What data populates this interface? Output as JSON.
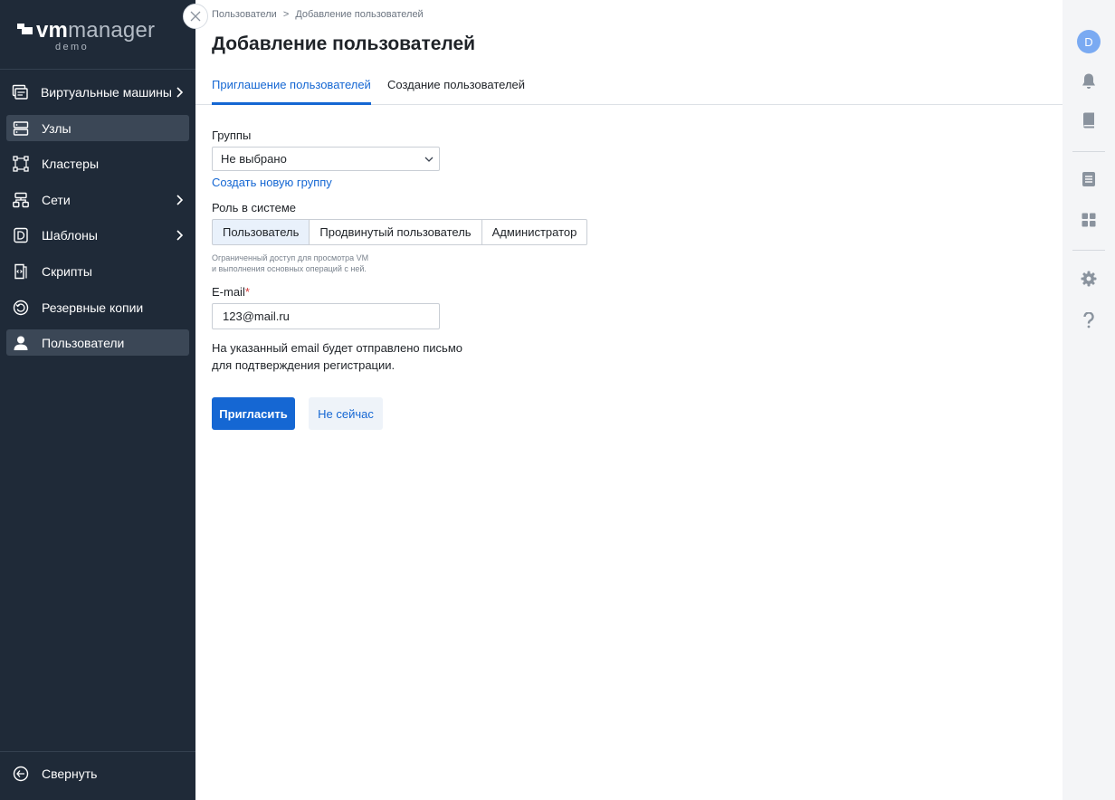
{
  "brand": {
    "vm": "vm",
    "manager": "manager",
    "demo": "demo"
  },
  "sidebar": {
    "items": [
      {
        "label": "Виртуальные машины",
        "icon": "vm-icon",
        "has_arrow": true,
        "active": false
      },
      {
        "label": "Узлы",
        "icon": "nodes-icon",
        "has_arrow": false,
        "active": true
      },
      {
        "label": "Кластеры",
        "icon": "clusters-icon",
        "has_arrow": false,
        "active": false
      },
      {
        "label": "Сети",
        "icon": "network-icon",
        "has_arrow": true,
        "active": false
      },
      {
        "label": "Шаблоны",
        "icon": "templates-icon",
        "has_arrow": true,
        "active": false
      },
      {
        "label": "Скрипты",
        "icon": "scripts-icon",
        "has_arrow": false,
        "active": false
      },
      {
        "label": "Резервные копии",
        "icon": "backup-icon",
        "has_arrow": false,
        "active": false
      },
      {
        "label": "Пользователи",
        "icon": "user-icon",
        "has_arrow": false,
        "active": true
      }
    ],
    "collapse_label": "Свернуть"
  },
  "breadcrumb": {
    "parent": "Пользователи",
    "separator": ">",
    "current": "Добавление пользователей"
  },
  "page_title": "Добавление пользователей",
  "tabs": [
    {
      "label": "Приглашение пользователей",
      "active": true
    },
    {
      "label": "Создание пользователей",
      "active": false
    }
  ],
  "form": {
    "groups_label": "Группы",
    "groups_value": "Не выбрано",
    "create_group_link": "Создать новую группу",
    "role_label": "Роль в системе",
    "roles": [
      {
        "label": "Пользователь",
        "selected": true
      },
      {
        "label": "Продвинутый пользователь",
        "selected": false
      },
      {
        "label": "Администратор",
        "selected": false
      }
    ],
    "role_hint_line1": "Ограниченный доступ для просмотра VM",
    "role_hint_line2": "и выполнения основных операций с ней.",
    "email_label": "E-mail",
    "email_required_mark": "*",
    "email_value": "123@mail.ru",
    "note_line1": "На указанный email будет отправлено письмо",
    "note_line2": "для подтверждения регистрации.",
    "invite_button": "Пригласить",
    "cancel_button": "Не сейчас"
  },
  "rail": {
    "avatar_letter": "D",
    "icons": [
      "bell-icon",
      "book-icon",
      "document-icon",
      "dashboard-icon",
      "settings-icon",
      "help-icon"
    ]
  },
  "colors": {
    "sidebar_bg": "#1f2a38",
    "accent": "#1567d3",
    "active_item": "#3b4756",
    "avatar": "#7aaaf2"
  }
}
